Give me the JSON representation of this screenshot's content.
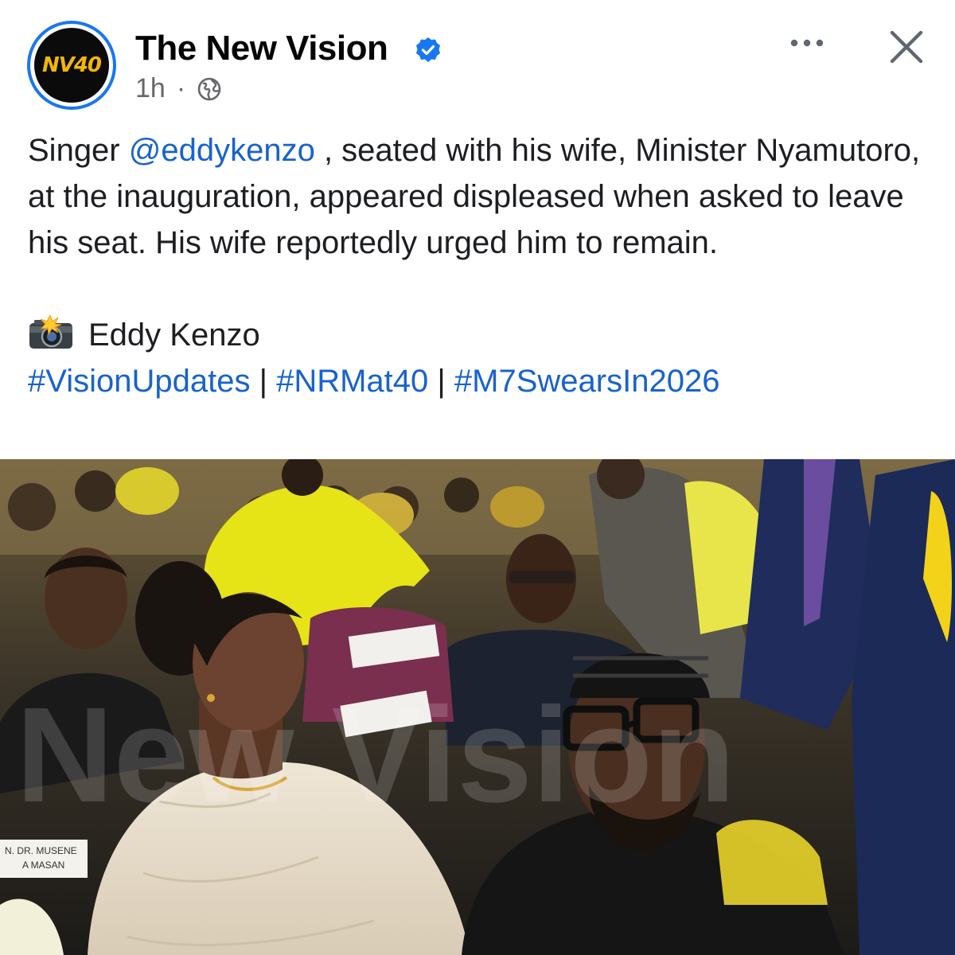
{
  "post": {
    "page_name": "The New Vision",
    "avatar_logo_text": "NV40",
    "timestamp": "1h",
    "meta_separator": "·",
    "audience_icon": "globe-icon",
    "verified_icon": "verified-badge-icon",
    "more_icon": "more-options-icon",
    "close_icon": "close-icon",
    "text": {
      "part1": "Singer ",
      "mention": "@eddykenzo",
      "part2": " , seated with his wife, Minister Nyamutoro, at the inauguration, appeared displeased when asked to leave his seat. His wife reportedly urged him to remain."
    },
    "credit": {
      "icon": "camera-flash-icon",
      "name": "Eddy Kenzo"
    },
    "hashtags": [
      "#VisionUpdates",
      "#NRMat40",
      "#M7SwearsIn2026"
    ],
    "hashtag_separator": " | ",
    "photo": {
      "watermark": "New Vision",
      "seat_labels": [
        "N. DR. MUSENE",
        "A MASAN"
      ]
    }
  },
  "colors": {
    "link": "#1763cf",
    "verified": "#1877f2",
    "secondary_text": "#65676b",
    "avatar_ring": "#1877f2"
  }
}
